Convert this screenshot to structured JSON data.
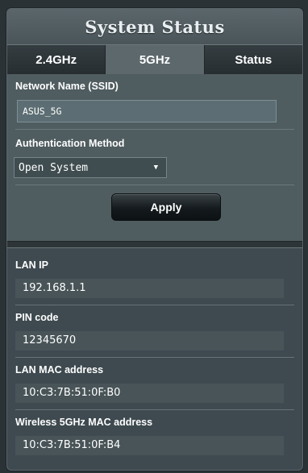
{
  "header": {
    "title": "System Status"
  },
  "tabs": [
    {
      "label": "2.4GHz",
      "active": false
    },
    {
      "label": "5GHz",
      "active": true
    },
    {
      "label": "Status",
      "active": false
    }
  ],
  "wifi": {
    "ssid_label": "Network Name (SSID)",
    "ssid_value": "ASUS_5G",
    "auth_label": "Authentication Method",
    "auth_value": "Open System",
    "apply_label": "Apply"
  },
  "info": [
    {
      "label": "LAN IP",
      "value": "192.168.1.1"
    },
    {
      "label": "PIN code",
      "value": "12345670"
    },
    {
      "label": "LAN MAC address",
      "value": "10:C3:7B:51:0F:B0"
    },
    {
      "label": "Wireless 5GHz MAC address",
      "value": "10:C3:7B:51:0F:B4"
    }
  ],
  "colors": {
    "panel_bg": "#3e4a50",
    "active_tab": "#5d686c",
    "button_dark": "#141a1d"
  }
}
